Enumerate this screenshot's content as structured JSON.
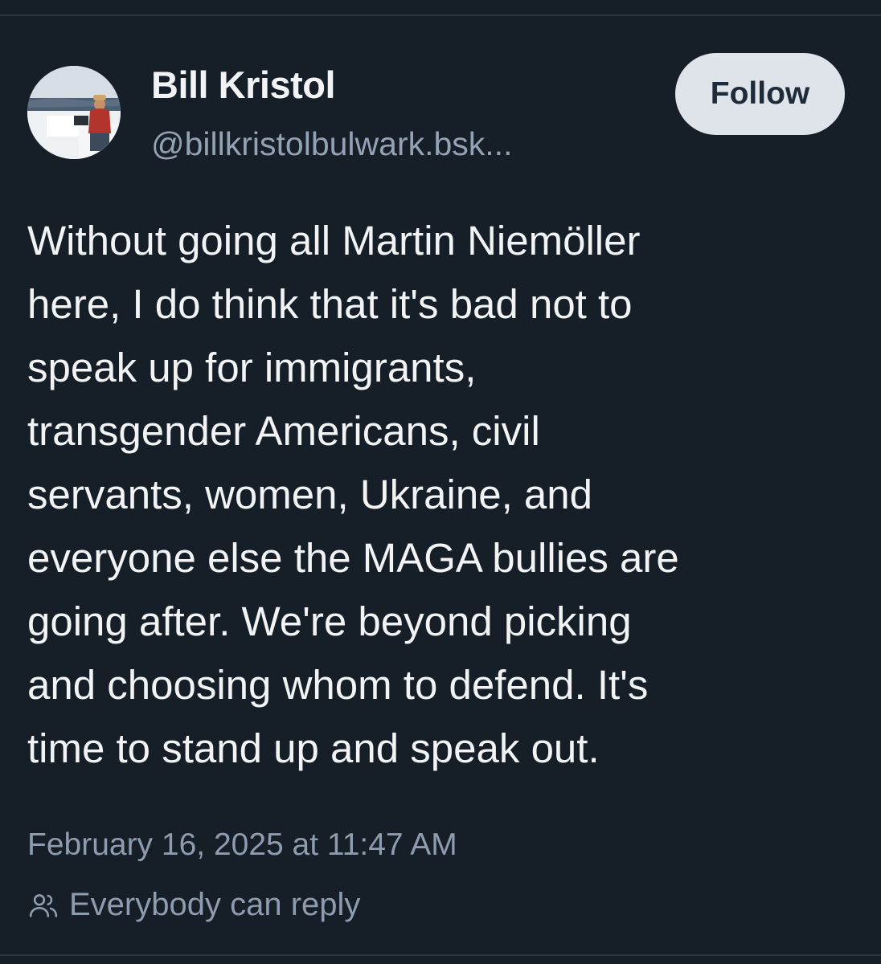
{
  "post": {
    "author": {
      "display_name": "Bill Kristol",
      "handle": "@billkristolbulwark.bsk..."
    },
    "follow_label": "Follow",
    "text_lines": [
      "Without going all Martin Niemöller",
      "here, I do think that it's bad not to",
      "speak up for immigrants,",
      "transgender Americans, civil",
      "servants, women, Ukraine, and",
      "everyone else the MAGA bullies are",
      "going after. We're beyond picking",
      "and choosing whom to defend. It's",
      "time to stand up and speak out."
    ],
    "timestamp": "February 16, 2025 at 11:47 AM",
    "reply_setting": {
      "icon": "people-icon",
      "label": "Everybody can reply"
    }
  },
  "colors": {
    "background": "#161e27",
    "text": "#f1f3f5",
    "muted": "#8d9cae",
    "follow_bg": "#dfe4ea",
    "follow_text": "#1f2b38"
  }
}
